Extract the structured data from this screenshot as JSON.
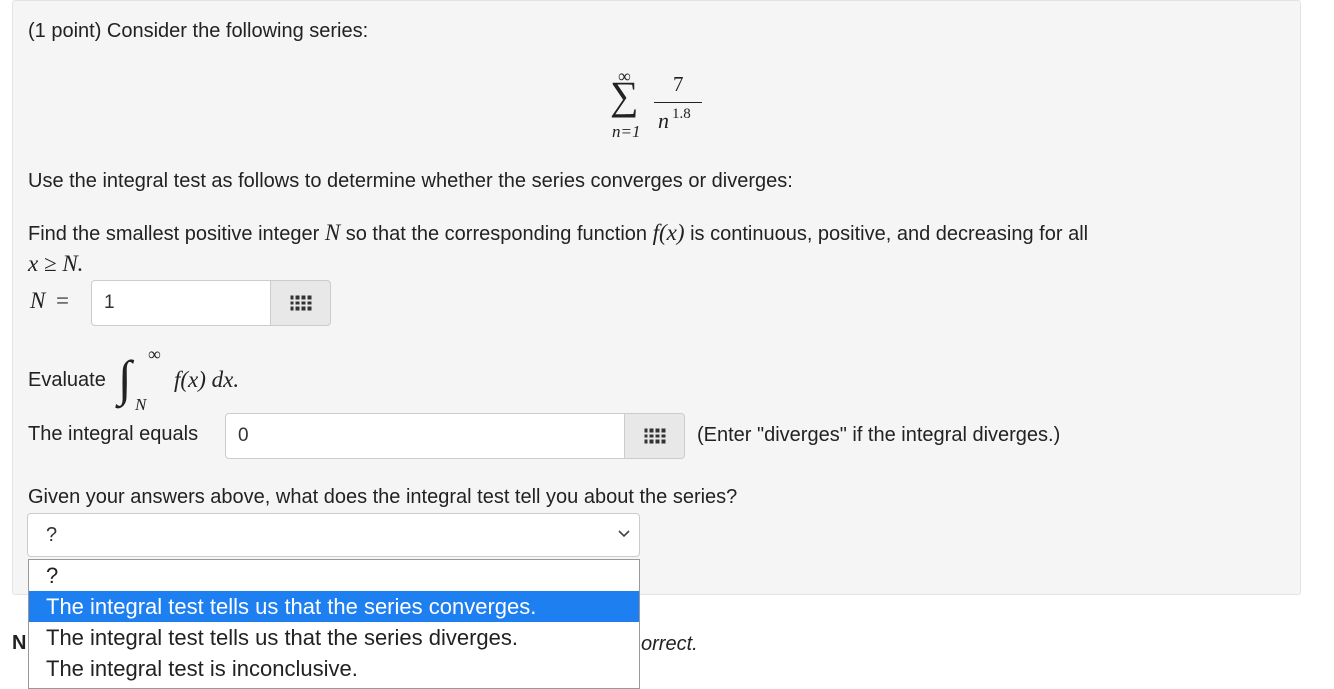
{
  "problem": {
    "intro": "(1 point) Consider the following series:",
    "series": {
      "upper": "∞",
      "numerator": "7",
      "base": "n",
      "exponent": "1.8",
      "lower": "n=1"
    },
    "instructions": "Use the integral test as follows to determine whether the series converges or diverges:",
    "find_text_1": "Find the smallest positive integer",
    "find_var": "N",
    "find_text_2": "so that the corresponding function",
    "find_func": "f(x)",
    "find_text_3": "is continuous, positive, and decreasing for all",
    "find_cond": "x ≥ N.",
    "n_label": "N",
    "n_equals": "=",
    "n_value": "1",
    "evaluate_label": "Evaluate",
    "integral_upper": "∞",
    "integral_lower": "N",
    "integrand": "f(x) dx.",
    "integral_equals_label": "The integral equals",
    "integral_value": "0",
    "integral_hint": "(Enter \"diverges\" if the integral diverges.)",
    "question": "Given your answers above, what does the integral test tell you about the series?",
    "select_value": "?",
    "options": [
      "?",
      "The integral test tells us that the series converges.",
      "The integral test tells us that the series diverges.",
      "The integral test is inconclusive."
    ],
    "footer_left": "N",
    "footer_right": "orrect."
  }
}
